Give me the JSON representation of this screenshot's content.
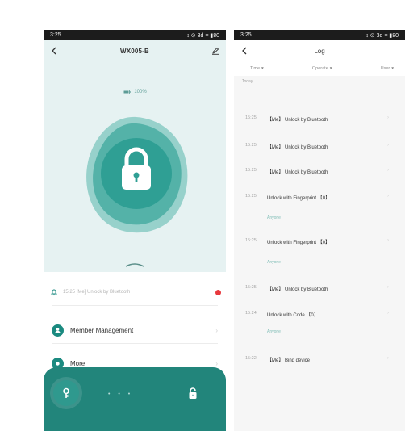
{
  "left_screen": {
    "status": {
      "time": "3:25",
      "icons": "↕ ⊙ 3d ≡ ▮80"
    },
    "nav": {
      "title": "WX005-B",
      "back_icon": "chevron-left-icon",
      "edit_icon": "pencil-icon"
    },
    "battery": {
      "level_percent": 100,
      "label": "100%"
    },
    "lock": {
      "icon": "padlock-icon",
      "state": "locked"
    },
    "recent": {
      "text": "15:25  [Me]  Unlock by Bluetooth",
      "has_unread": true
    },
    "menu": [
      {
        "label": "Member Management",
        "icon": "person-icon"
      },
      {
        "label": "More",
        "icon": "more-dots-icon"
      }
    ],
    "dock": {
      "dots": "• • •",
      "key_icon": "key-icon",
      "unlock_icon": "unlock-icon"
    }
  },
  "right_screen": {
    "status": {
      "time": "3:25",
      "icons": "↕ ⊙ 3d ≡ ▮80"
    },
    "nav": {
      "title": "Log",
      "back_icon": "chevron-left-icon"
    },
    "filters": [
      "Time",
      "Operate",
      "User"
    ],
    "section": "Today",
    "entries": [
      {
        "time": "15:25",
        "text": "【Me】 Unlock by Bluetooth",
        "sub": ""
      },
      {
        "time": "15:25",
        "text": "【Me】 Unlock by Bluetooth",
        "sub": ""
      },
      {
        "time": "15:25",
        "text": "【Me】 Unlock by Bluetooth",
        "sub": ""
      },
      {
        "time": "15:25",
        "text": "Unlock with Fingerprint 【0】",
        "sub": "Anyone"
      },
      {
        "time": "15:25",
        "text": "Unlock with Fingerprint 【0】",
        "sub": "Anyone"
      },
      {
        "time": "15:25",
        "text": "【Me】 Unlock by Bluetooth",
        "sub": ""
      },
      {
        "time": "15:24",
        "text": "Unlock with Code 【0】",
        "sub": "Anyone"
      },
      {
        "time": "15:22",
        "text": "【Me】 Bind device",
        "sub": ""
      }
    ]
  },
  "colors": {
    "teal": "#22857b",
    "teal_light": "#56b6ac",
    "bg_mint": "#e6f2f2",
    "alert_red": "#e8383d"
  }
}
